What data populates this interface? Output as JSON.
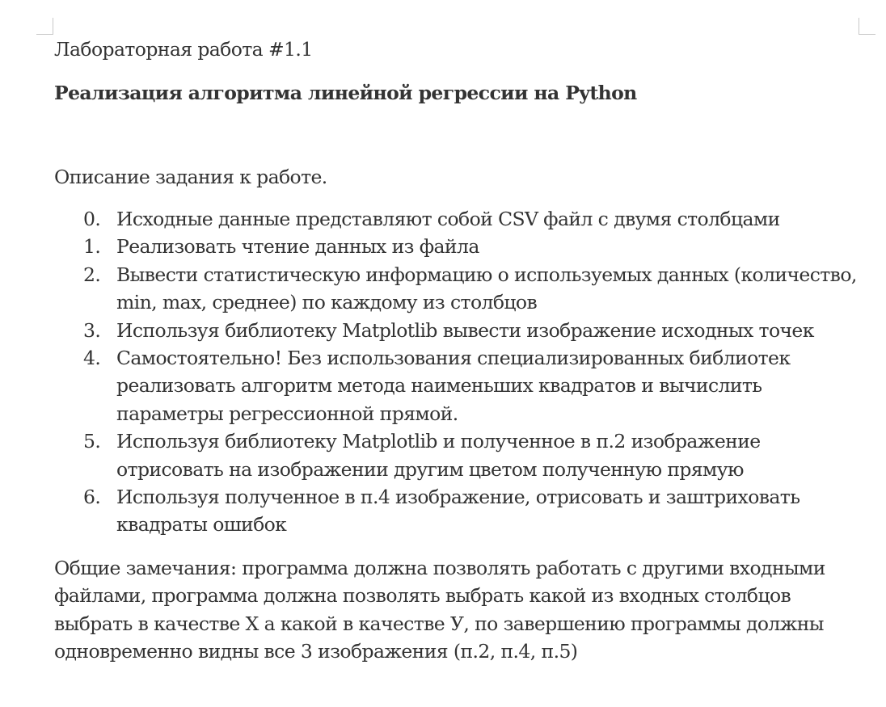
{
  "document": {
    "title": "Лабораторная работа #1.1",
    "subtitle": "Реализация алгоритма линейной регрессии на Python",
    "description_heading": "Описание задания к работе.",
    "tasks": [
      {
        "number": "0.",
        "lines": [
          "Исходные данные представляют собой CSV файл с двумя столбцами"
        ]
      },
      {
        "number": "1.",
        "lines": [
          "Реализовать чтение данных из файла"
        ]
      },
      {
        "number": "2.",
        "lines": [
          "Вывести статистическую информацию о используемых данных (количество,",
          "min, max, среднее) по каждому из столбцов"
        ]
      },
      {
        "number": "3.",
        "lines": [
          "Используя библиотеку Matplotlib вывести изображение исходных точек"
        ]
      },
      {
        "number": "4.",
        "lines": [
          "Самостоятельно! Без использования специализированных библиотек",
          "реализовать алгоритм метода наименьших квадратов и вычислить",
          "параметры регрессионной прямой."
        ]
      },
      {
        "number": "5.",
        "lines": [
          "Используя библиотеку Matplotlib и полученное в п.2 изображение",
          "отрисовать на изображении другим цветом полученную прямую"
        ]
      },
      {
        "number": "6.",
        "lines": [
          "Используя полученное в п.4 изображение, отрисовать и заштриховать",
          "квадраты ошибок"
        ]
      }
    ],
    "remarks_lines": [
      "Общие замечания: программа должна позволять работать с другими входными",
      "файлами, программа должна позволять выбрать какой из входных столбцов",
      "выбрать в качестве X а какой в качестве У, по завершению программы должны",
      "одновременно видны все 3 изображения (п.2, п.4, п.5)"
    ]
  }
}
